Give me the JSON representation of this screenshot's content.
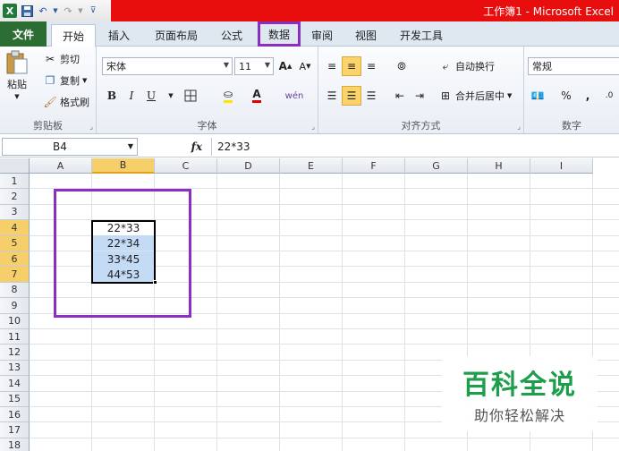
{
  "window": {
    "title": "工作簿1 - Microsoft Excel"
  },
  "qat": {
    "logo": "X",
    "save_icon": "save-icon",
    "undo_icon": "undo-icon",
    "redo_icon": "redo-icon"
  },
  "tabs": [
    {
      "label": "文件"
    },
    {
      "label": "开始"
    },
    {
      "label": "插入"
    },
    {
      "label": "页面布局"
    },
    {
      "label": "公式"
    },
    {
      "label": "数据"
    },
    {
      "label": "审阅"
    },
    {
      "label": "视图"
    },
    {
      "label": "开发工具"
    }
  ],
  "ribbon": {
    "clipboard": {
      "paste": "粘贴",
      "cut": "剪切",
      "copy": "复制",
      "format_painter": "格式刷",
      "label": "剪贴板"
    },
    "font": {
      "name": "宋体",
      "size": "11",
      "bold": "B",
      "italic": "I",
      "underline": "U",
      "label": "字体",
      "grow": "A",
      "shrink": "A",
      "phonetic": "wén"
    },
    "alignment": {
      "wrap": "自动换行",
      "merge": "合并后居中",
      "label": "对齐方式"
    },
    "number": {
      "format": "常规",
      "percent": "%",
      "comma": ",",
      "label": "数字"
    }
  },
  "formula_bar": {
    "name_box": "B4",
    "fx": "fx",
    "formula": "22*33"
  },
  "columns": [
    "A",
    "B",
    "C",
    "D",
    "E",
    "F",
    "G",
    "H",
    "I"
  ],
  "rows": [
    "1",
    "2",
    "3",
    "4",
    "5",
    "6",
    "7",
    "8",
    "9",
    "10",
    "11",
    "12",
    "13",
    "14",
    "15",
    "16",
    "17",
    "18"
  ],
  "cells": {
    "B4": "22*33",
    "B5": "22*34",
    "B6": "33*45",
    "B7": "44*53"
  },
  "watermark": {
    "title": "百科全说",
    "subtitle": "助你轻松解决"
  },
  "colors": {
    "title_red": "#e80e0e",
    "file_tab": "#2c6d34",
    "highlight_purple": "#8a2fbf",
    "selection": "#c3dbf5",
    "header_selected": "#f6cf6b"
  }
}
